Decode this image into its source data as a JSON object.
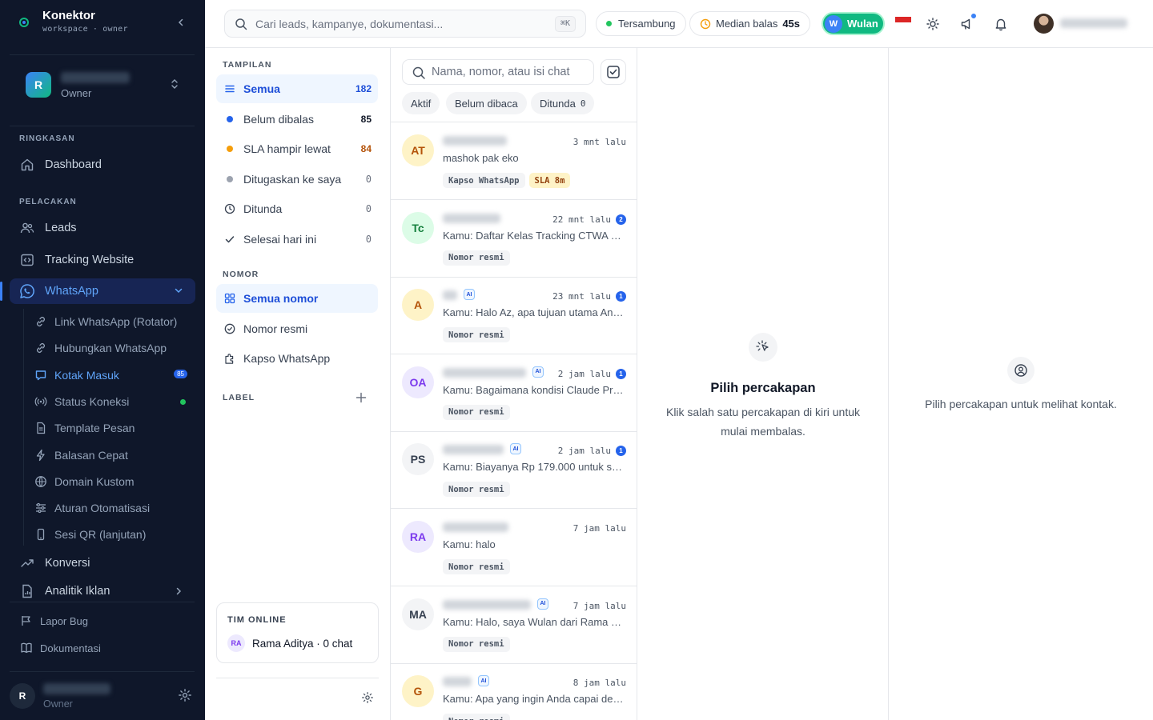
{
  "app": {
    "name": "Konektor",
    "sub_workspace": "workspace",
    "sub_role": "owner"
  },
  "workspace": {
    "initial": "R",
    "role": "Owner"
  },
  "sidebar": {
    "sections": {
      "summary": "RINGKASAN",
      "tracking": "PELACAKAN"
    },
    "dashboard": "Dashboard",
    "leads": "Leads",
    "tracking_website": "Tracking Website",
    "whatsapp": "WhatsApp",
    "whatsapp_sub": [
      {
        "label": "Link WhatsApp (Rotator)",
        "icon": "link-icon"
      },
      {
        "label": "Hubungkan WhatsApp",
        "icon": "link-icon"
      },
      {
        "label": "Kotak Masuk",
        "icon": "chat-icon",
        "badge": "85",
        "active": true
      },
      {
        "label": "Status Koneksi",
        "icon": "signal-icon",
        "status_color": "#22c55e"
      },
      {
        "label": "Template Pesan",
        "icon": "file-icon"
      },
      {
        "label": "Balasan Cepat",
        "icon": "bolt-icon"
      },
      {
        "label": "Domain Kustom",
        "icon": "globe-icon"
      },
      {
        "label": "Aturan Otomatisasi",
        "icon": "sliders-icon"
      },
      {
        "label": "Sesi QR (lanjutan)",
        "icon": "phone-icon"
      }
    ],
    "konversi": "Konversi",
    "analitik_iklan": "Analitik Iklan",
    "lapor_bug": "Lapor Bug",
    "dokumentasi": "Dokumentasi",
    "user": {
      "initial": "R",
      "role": "Owner"
    }
  },
  "topbar": {
    "search_placeholder": "Cari leads, kampanye, dokumentasi...",
    "shortcut": "⌘K",
    "status": "Tersambung",
    "median_label": "Median balas",
    "median_value": "45s",
    "agent_initial": "W",
    "agent_name": "Wulan"
  },
  "filters": {
    "view_label": "TAMPILAN",
    "views": [
      {
        "label": "Semua",
        "count": "182",
        "icon": "menu-icon",
        "active": true
      },
      {
        "label": "Belum dibalas",
        "count": "85",
        "icon": "dot-blue-icon",
        "color": "#2563eb"
      },
      {
        "label": "SLA hampir lewat",
        "count": "84",
        "icon": "dot-amber-icon",
        "color": "#f59e0b"
      },
      {
        "label": "Ditugaskan ke saya",
        "count": "0",
        "icon": "dot-gray-icon",
        "color": "#9ca3af"
      },
      {
        "label": "Ditunda",
        "count": "0",
        "icon": "clock-icon"
      },
      {
        "label": "Selesai hari ini",
        "count": "0",
        "icon": "check-icon"
      }
    ],
    "number_label": "NOMOR",
    "numbers": [
      {
        "label": "Semua nomor",
        "icon": "grid-icon",
        "active": true
      },
      {
        "label": "Nomor resmi",
        "icon": "badge-check-icon"
      },
      {
        "label": "Kapso WhatsApp",
        "icon": "puzzle-icon"
      }
    ],
    "label_label": "LABEL",
    "team_online_label": "TIM ONLINE",
    "team_member": {
      "initials": "RA",
      "text": "Rama Aditya · 0 chat"
    }
  },
  "conversations": {
    "search_placeholder": "Nama, nomor, atau isi chat",
    "chips": [
      {
        "label": "Aktif"
      },
      {
        "label": "Belum dibaca"
      },
      {
        "label": "Ditunda",
        "count": "0"
      }
    ],
    "items": [
      {
        "initials": "AT",
        "bg": "#fef3c7",
        "fg": "#b45309",
        "time": "3 mnt lalu",
        "preview": "mashok pak eko",
        "tags": [
          "Kapso WhatsApp"
        ],
        "sla": "SLA 8m"
      },
      {
        "initials": "Tc",
        "bg": "#dcfce7",
        "fg": "#15803d",
        "time": "22 mnt lalu",
        "unread": "2",
        "preview": "Kamu: Daftar Kelas Tracking CTWA — I…",
        "tags": [
          "Nomor resmi"
        ]
      },
      {
        "initials": "A",
        "bg": "#fef3c7",
        "fg": "#b45309",
        "ai": "AI",
        "time": "23 mnt lalu",
        "unread": "1",
        "preview": "Kamu: Halo Az, apa tujuan utama And…",
        "tags": [
          "Nomor resmi"
        ]
      },
      {
        "initials": "OA",
        "bg": "#ede9fe",
        "fg": "#7c3aed",
        "ai": "AI",
        "time": "2 jam lalu",
        "unread": "1",
        "preview": "Kamu: Bagaimana kondisi Claude Pro…",
        "tags": [
          "Nomor resmi"
        ]
      },
      {
        "initials": "PS",
        "bg": "#f3f4f6",
        "fg": "#374151",
        "ai": "AI",
        "time": "2 jam lalu",
        "unread": "1",
        "preview": "Kamu: Biayanya Rp 179.000 untuk sat…",
        "tags": [
          "Nomor resmi"
        ]
      },
      {
        "initials": "RA",
        "bg": "#ede9fe",
        "fg": "#7c3aed",
        "time": "7 jam lalu",
        "preview": "Kamu: halo",
        "tags": [
          "Nomor resmi"
        ]
      },
      {
        "initials": "MA",
        "bg": "#f3f4f6",
        "fg": "#374151",
        "ai": "AI",
        "time": "7 jam lalu",
        "preview": "Kamu: Halo, saya Wulan dari Rama Di…",
        "tags": [
          "Nomor resmi"
        ]
      },
      {
        "initials": "G",
        "bg": "#fef3c7",
        "fg": "#b45309",
        "ai": "AI",
        "time": "8 jam lalu",
        "preview": "Kamu: Apa yang ingin Anda capai den…",
        "tags": [
          "Nomor resmi"
        ]
      }
    ]
  },
  "chat": {
    "title": "Pilih percakapan",
    "desc": "Klik salah satu percakapan di kiri untuk mulai membalas."
  },
  "contact": {
    "desc": "Pilih percakapan untuk melihat kontak."
  }
}
